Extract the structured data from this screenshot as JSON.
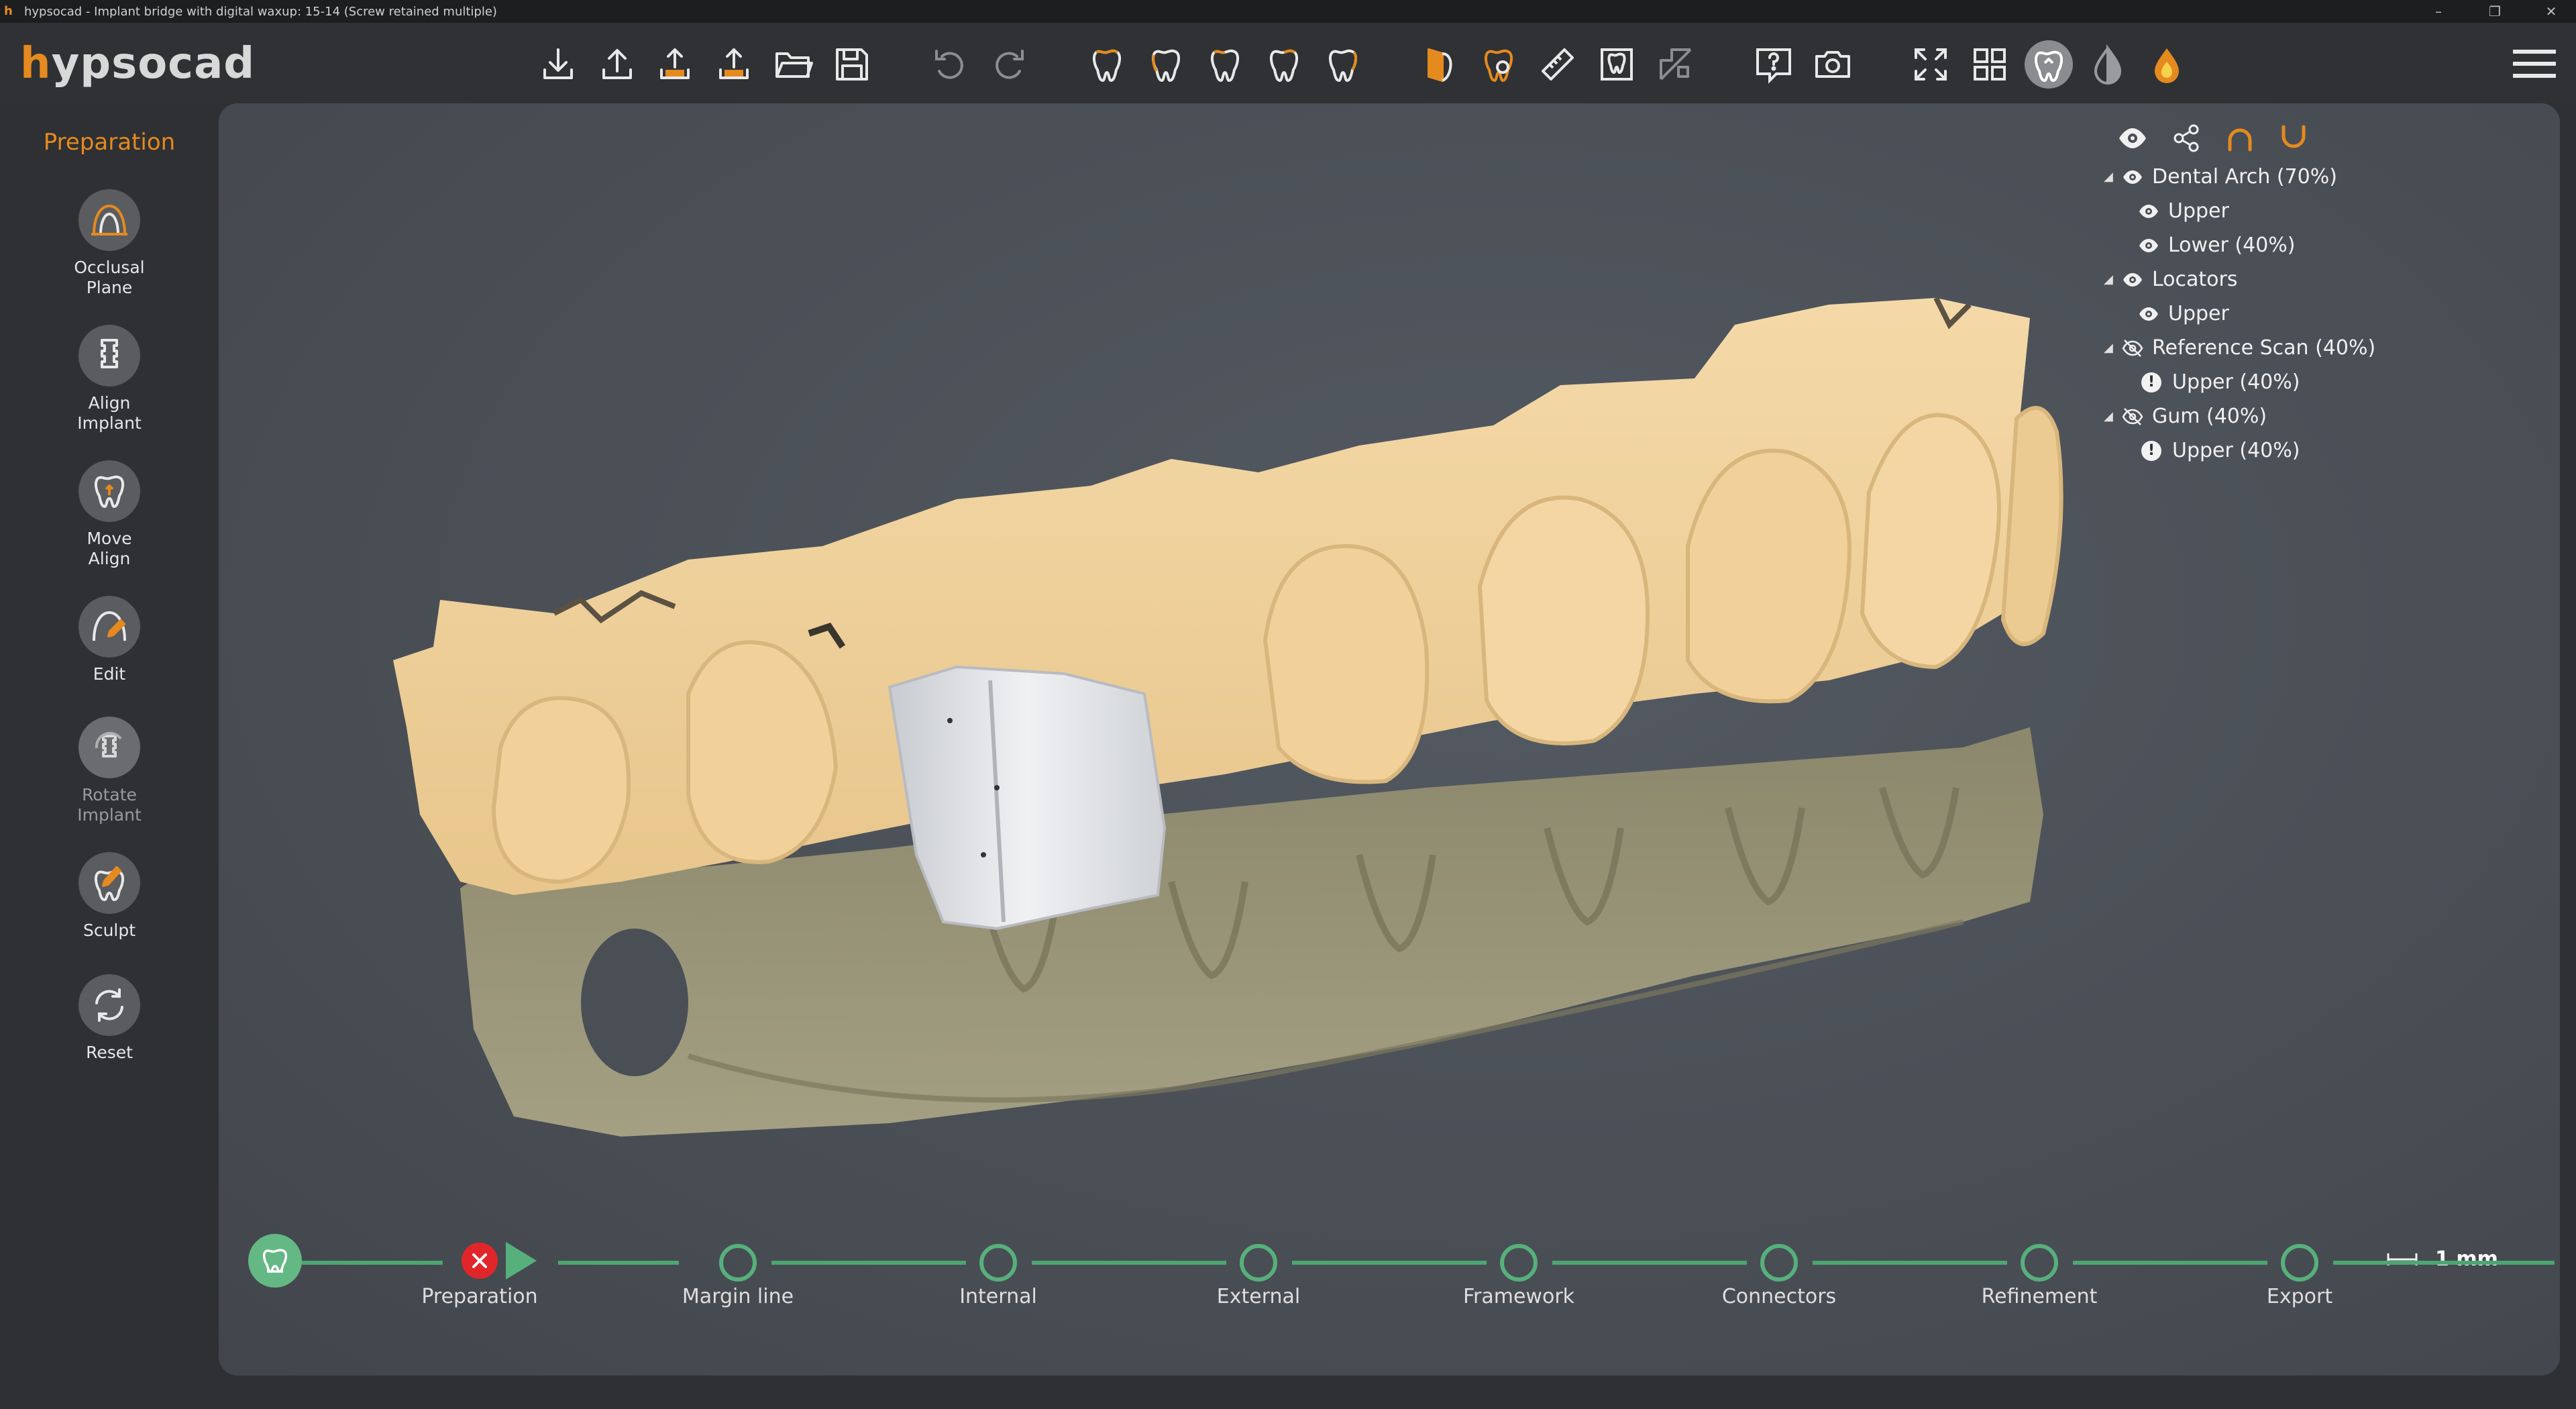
{
  "window": {
    "title": "hypsocad - Implant bridge  with digital waxup: 15-14 (Screw retained multiple)",
    "app_glyph": "h"
  },
  "logo": {
    "first": "h",
    "rest": "ypsocad"
  },
  "toolbar_icons": [
    "import-icon",
    "export-icon",
    "export-stl-icon",
    "export-html-icon",
    "open-folder-icon",
    "save-icon",
    "undo-icon",
    "redo-icon",
    "tooth-front-view-icon",
    "tooth-back-view-icon",
    "tooth-left-view-icon",
    "tooth-right-view-icon",
    "tooth-top-view-icon",
    "cutting-plane-icon",
    "transparency-toggle-icon",
    "measure-ruler-icon",
    "bounding-box-icon",
    "cross-section-icon",
    "help-icon",
    "screenshot-icon",
    "fullscreen-icon",
    "grid-layout-icon",
    "tooth-mode-icon",
    "water-drop-icon",
    "fire-drop-icon"
  ],
  "left_panel": {
    "title": "Preparation",
    "tools": [
      {
        "label_1": "Occlusal",
        "label_2": "Plane",
        "icon": "occlusal-plane-icon"
      },
      {
        "label_1": "Align",
        "label_2": "Implant",
        "icon": "align-implant-icon"
      },
      {
        "label_1": "Move",
        "label_2": "Align",
        "icon": "move-align-icon"
      },
      {
        "label_1": "Edit",
        "label_2": "",
        "icon": "edit-icon"
      },
      {
        "label_1": "Rotate",
        "label_2": "Implant",
        "icon": "rotate-implant-icon",
        "disabled": true
      },
      {
        "label_1": "Sculpt",
        "label_2": "",
        "icon": "sculpt-icon"
      },
      {
        "label_1": "Reset",
        "label_2": "",
        "icon": "reset-icon"
      }
    ]
  },
  "scene_tree": {
    "items": [
      {
        "label": "Dental Arch (70%)",
        "level": 0,
        "visible": true
      },
      {
        "label": "Upper",
        "level": 1,
        "visible": true
      },
      {
        "label": "Lower (40%)",
        "level": 1,
        "visible": true
      },
      {
        "label": "Locators",
        "level": 0,
        "visible": true
      },
      {
        "label": "Upper",
        "level": 1,
        "visible": true
      },
      {
        "label": "Reference Scan (40%)",
        "level": 0,
        "visible": false
      },
      {
        "label": "Upper (40%)",
        "level": 1,
        "warning": true
      },
      {
        "label": "Gum (40%)",
        "level": 0,
        "visible": false
      },
      {
        "label": "Upper (40%)",
        "level": 1,
        "warning": true
      }
    ]
  },
  "scale_bar": {
    "label": "1 mm"
  },
  "workflow": {
    "steps": [
      {
        "label": "Preparation",
        "state": "error"
      },
      {
        "label": "Margin line",
        "state": "pending"
      },
      {
        "label": "Internal",
        "state": "pending"
      },
      {
        "label": "External",
        "state": "pending"
      },
      {
        "label": "Framework",
        "state": "pending"
      },
      {
        "label": "Connectors",
        "state": "pending"
      },
      {
        "label": "Refinement",
        "state": "pending"
      },
      {
        "label": "Export",
        "state": "pending"
      }
    ],
    "colors": {
      "line": "#4da672",
      "error": "#e0262a"
    }
  },
  "colors": {
    "accent": "#e58a1f",
    "upper_jaw": "#f2d3a0",
    "lower_jaw": "#aea68a",
    "implant": "#e4e6ea"
  }
}
